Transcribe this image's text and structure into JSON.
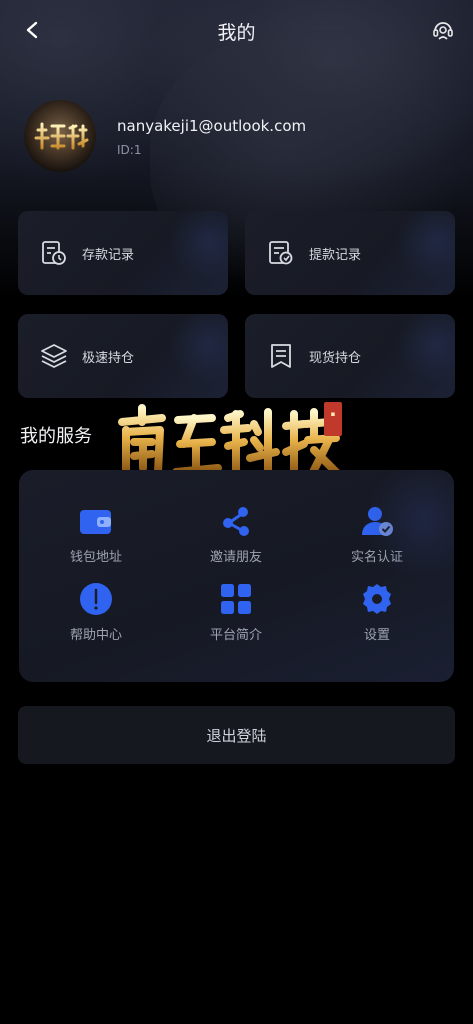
{
  "header": {
    "title": "我的",
    "back_icon": "chevron-left-icon",
    "support_icon": "headset-icon"
  },
  "profile": {
    "email": "nanyakeji1@outlook.com",
    "id_text": "ID:1"
  },
  "quick_cards": [
    {
      "label": "存款记录",
      "icon": "deposit-history-icon"
    },
    {
      "label": "提款记录",
      "icon": "withdraw-history-icon"
    },
    {
      "label": "极速持仓",
      "icon": "layers-icon"
    },
    {
      "label": "现货持仓",
      "icon": "bookmark-list-icon"
    }
  ],
  "services": {
    "title": "我的服务",
    "items": [
      {
        "label": "钱包地址",
        "icon": "wallet-icon"
      },
      {
        "label": "邀请朋友",
        "icon": "share-icon"
      },
      {
        "label": "实名认证",
        "icon": "user-verified-icon"
      },
      {
        "label": "帮助中心",
        "icon": "help-icon"
      },
      {
        "label": "平台简介",
        "icon": "grid-icon"
      },
      {
        "label": "设置",
        "icon": "settings-icon"
      }
    ]
  },
  "logout_label": "退出登陆",
  "colors": {
    "accent": "#2f63f0",
    "background": "#000000",
    "card": "#1a1d28"
  }
}
